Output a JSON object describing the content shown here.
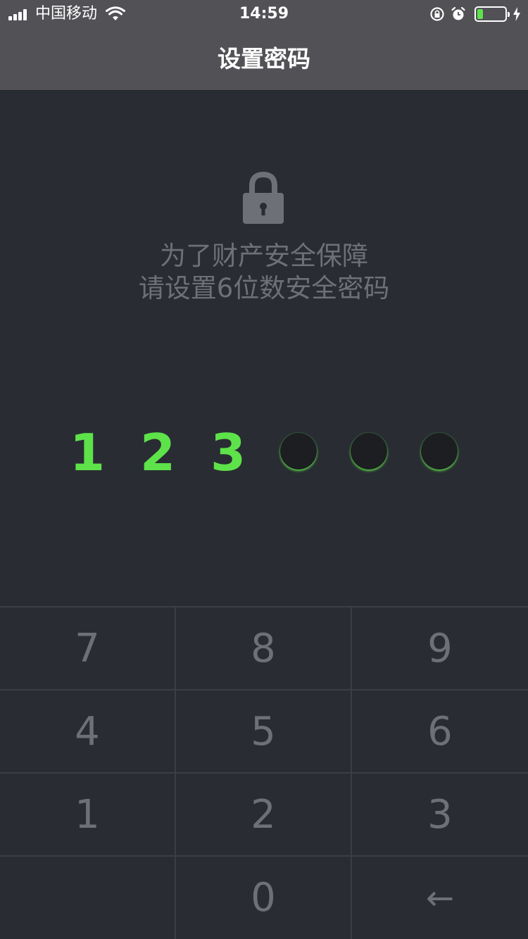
{
  "status_bar": {
    "carrier": "中国移动",
    "time": "14:59",
    "battery_level": 0.2
  },
  "nav": {
    "title": "设置密码"
  },
  "prompt": {
    "line1": "为了财产安全保障",
    "line2": "请设置6位数安全密码"
  },
  "pin": {
    "entered": [
      "1",
      "2",
      "3"
    ],
    "length": 6
  },
  "keypad": {
    "rows": [
      [
        "7",
        "8",
        "9"
      ],
      [
        "4",
        "5",
        "6"
      ],
      [
        "1",
        "2",
        "3"
      ],
      [
        "",
        "0",
        "←"
      ]
    ]
  },
  "colors": {
    "accent": "#5ee24a",
    "background": "#292d33",
    "nav": "#525156",
    "muted_text": "#6d7177"
  },
  "icons": {
    "lock": "lock-icon",
    "backspace": "backspace-arrow"
  }
}
